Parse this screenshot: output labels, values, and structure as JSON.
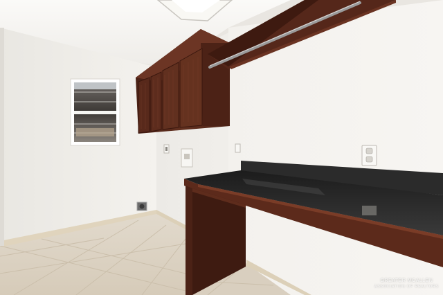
{
  "scene": {
    "subject": "laundry room",
    "watermark_text": "GREATER MCALLEN",
    "watermark_subtext": "ASSOCIATION OF REALTORS"
  },
  "colors": {
    "wall": "#f2f0ec",
    "ceiling": "#f7f6f3",
    "floor_tile": "#ddd3c4",
    "wood_cabinet": "#5a2a1c",
    "countertop": "#262626",
    "baseboard": "#e2d6c0"
  }
}
